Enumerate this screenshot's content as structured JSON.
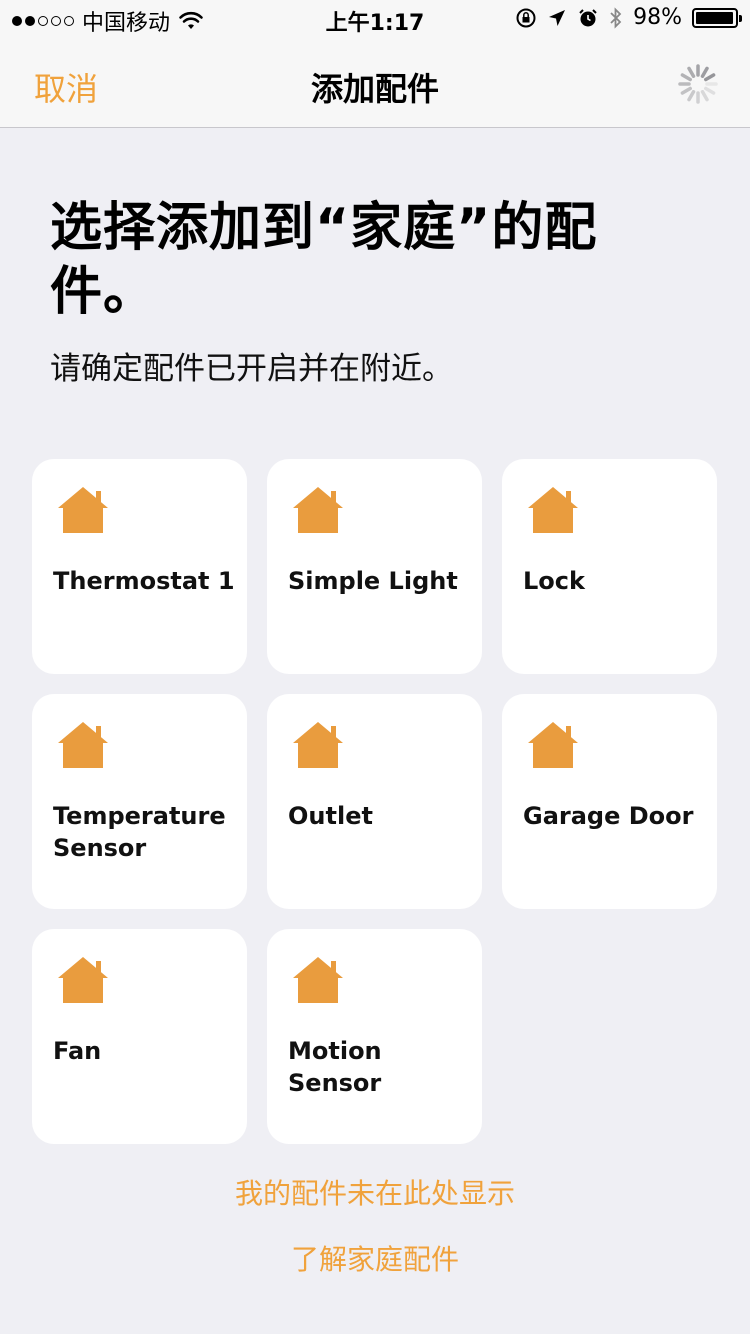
{
  "status_bar": {
    "carrier": "中国移动",
    "time": "上午1:17",
    "battery_percent": "98%",
    "battery_level": 0.98,
    "icons": [
      "signal-dots-icon",
      "wifi-icon",
      "rotation-lock-icon",
      "location-arrow-icon",
      "alarm-icon",
      "bluetooth-icon",
      "battery-icon"
    ]
  },
  "nav": {
    "cancel_label": "取消",
    "title": "添加配件",
    "activity_icon": "spinner-icon"
  },
  "header": {
    "title": "选择添加到“家庭”的配件。",
    "subtitle": "请确定配件已开启并在附近。"
  },
  "accessories": [
    {
      "name": "Thermostat 1",
      "icon": "home-icon"
    },
    {
      "name": "Simple Light",
      "icon": "home-icon"
    },
    {
      "name": "Lock",
      "icon": "home-icon"
    },
    {
      "name": "Temperature Sensor",
      "icon": "home-icon"
    },
    {
      "name": "Outlet",
      "icon": "home-icon"
    },
    {
      "name": "Garage Door",
      "icon": "home-icon"
    },
    {
      "name": "Fan",
      "icon": "home-icon"
    },
    {
      "name": "Motion Sensor",
      "icon": "home-icon"
    }
  ],
  "footer": {
    "not_shown_link": "我的配件未在此处显示",
    "learn_more_link": "了解家庭配件"
  },
  "colors": {
    "accent": "#f0a23c",
    "icon": "#e99c3e",
    "background": "#efeff4",
    "tile": "#ffffff"
  }
}
